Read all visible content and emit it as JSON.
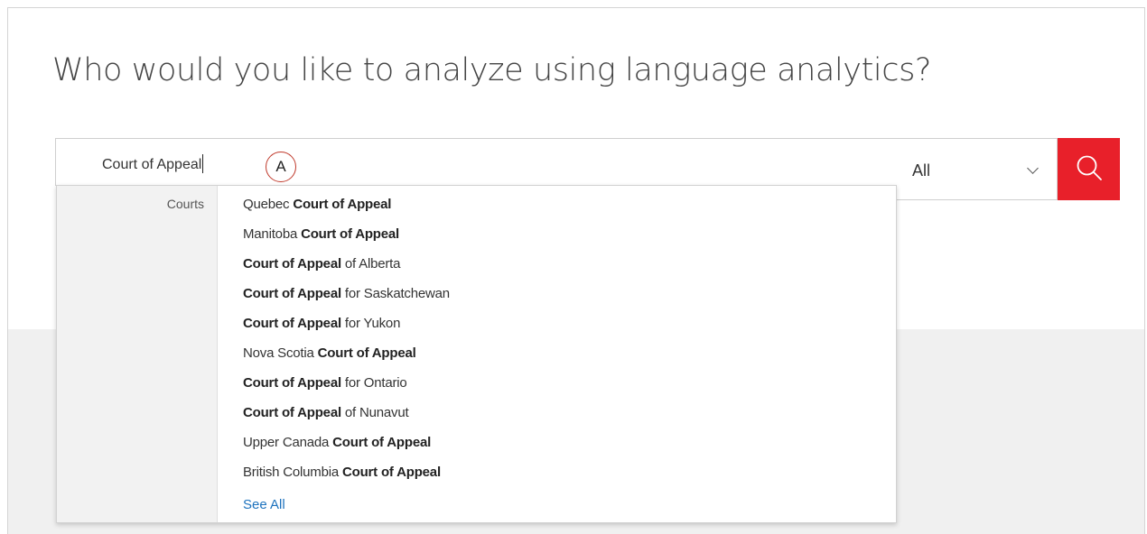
{
  "page": {
    "title": "Who would you like to analyze using language analytics?"
  },
  "search": {
    "value": "Court of Appeal",
    "annotation_marker": "A",
    "scope": "All"
  },
  "dropdown": {
    "category": "Courts",
    "items": [
      {
        "before": "Quebec ",
        "bold": "Court of Appeal",
        "after": ""
      },
      {
        "before": "Manitoba ",
        "bold": "Court of Appeal",
        "after": ""
      },
      {
        "before": "",
        "bold": "Court of Appeal",
        "after": " of Alberta"
      },
      {
        "before": "",
        "bold": "Court of Appeal",
        "after": " for Saskatchewan"
      },
      {
        "before": "",
        "bold": "Court of Appeal",
        "after": " for Yukon"
      },
      {
        "before": "Nova Scotia ",
        "bold": "Court of Appeal",
        "after": ""
      },
      {
        "before": "",
        "bold": "Court of Appeal",
        "after": " for Ontario"
      },
      {
        "before": "",
        "bold": "Court of Appeal",
        "after": " of Nunavut"
      },
      {
        "before": "Upper Canada ",
        "bold": "Court of Appeal",
        "after": ""
      },
      {
        "before": "British Columbia ",
        "bold": "Court of Appeal",
        "after": ""
      }
    ],
    "see_all_label": "See All"
  },
  "icons": {
    "search_button": "search-icon",
    "scope_toggle": "chevron-down-icon"
  },
  "colors": {
    "accent": "#e8202a",
    "link": "#1e73be"
  }
}
